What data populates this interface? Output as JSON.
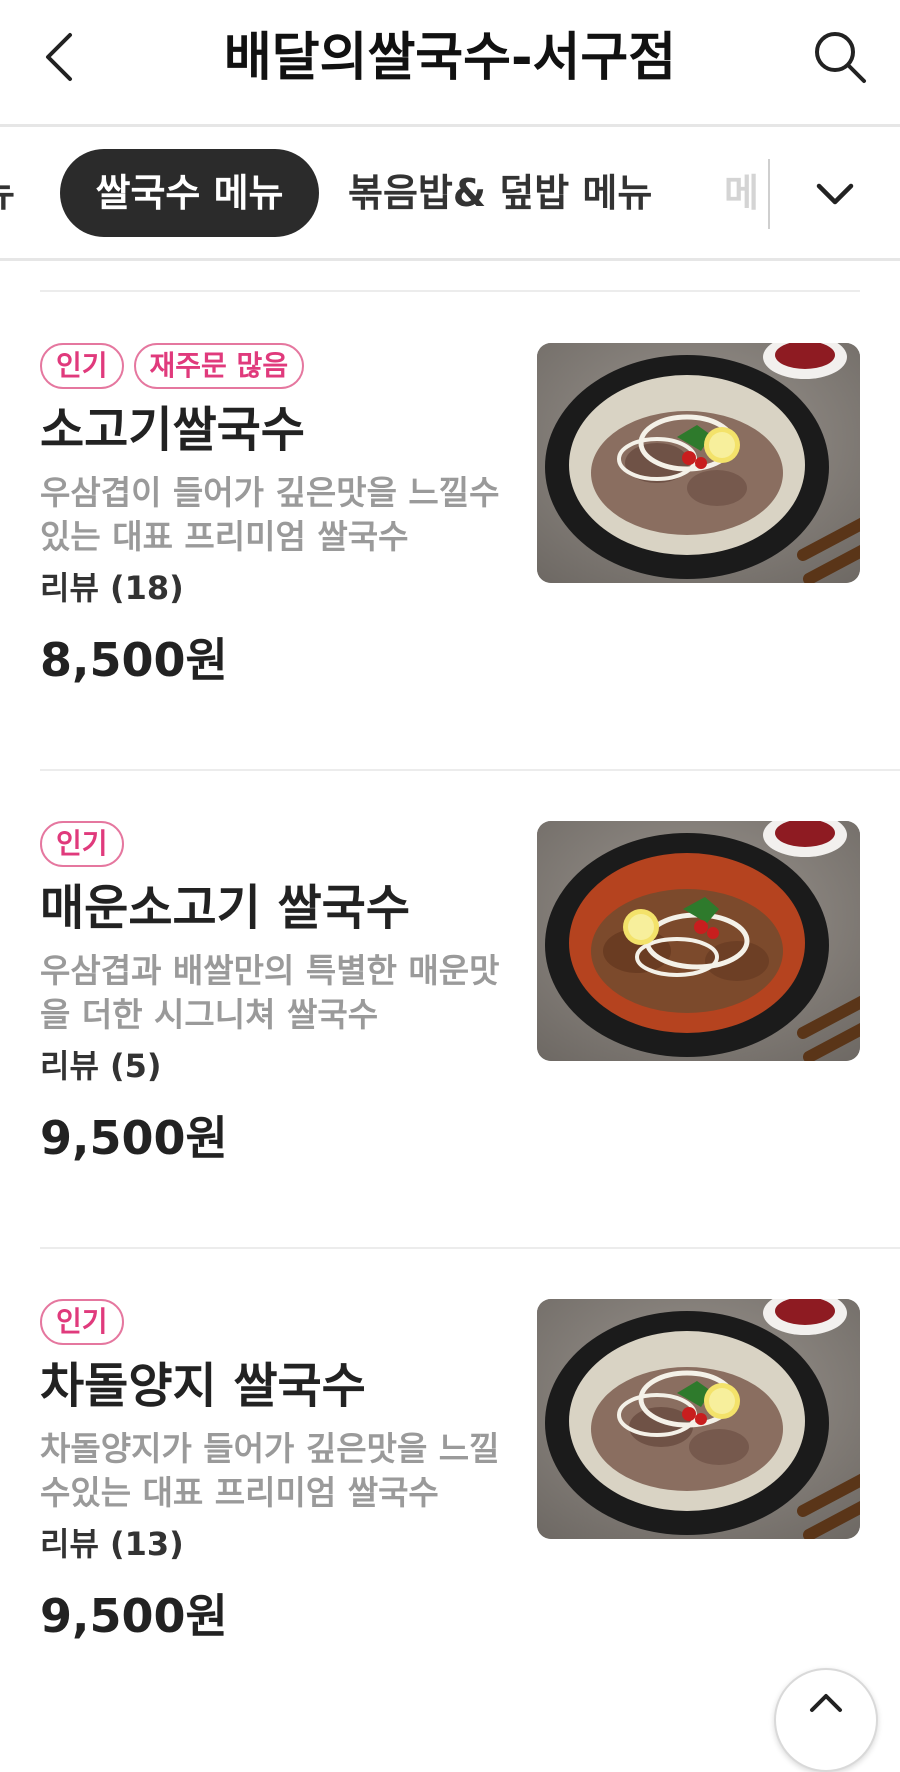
{
  "header": {
    "title": "배달의쌀국수-서구점",
    "back_icon": "chevron-left-icon",
    "search_icon": "search-icon"
  },
  "tabs": {
    "items": [
      {
        "label": "뉴",
        "state": "partial"
      },
      {
        "label": "쌀국수 메뉴",
        "state": "active"
      },
      {
        "label": "볶음밥& 덮밥 메뉴",
        "state": "normal"
      },
      {
        "label": "메",
        "state": "partial"
      }
    ],
    "toggle_icon": "chevron-down-icon"
  },
  "menu": {
    "items": [
      {
        "badges": [
          "인기",
          "재주문 많음"
        ],
        "name": "소고기쌀국수",
        "description": "우삼겹이 들어가 깊은맛을 느낄수있는 대표 프리미엄 쌀국수",
        "review": "리뷰 (18)",
        "price": "8,500원",
        "photo": "clear-broth-beef-pho"
      },
      {
        "badges": [
          "인기"
        ],
        "name": "매운소고기 쌀국수",
        "description": "우삼겹과 배쌀만의 특별한 매운맛을 더한 시그니쳐 쌀국수",
        "review": "리뷰 (5)",
        "price": "9,500원",
        "photo": "spicy-beef-pho"
      },
      {
        "badges": [
          "인기"
        ],
        "name": "차돌양지 쌀국수",
        "description": "차돌양지가 들어가 깊은맛을 느낄수있는 대표 프리미엄 쌀국수",
        "review": "리뷰 (13)",
        "price": "9,500원",
        "photo": "brisket-pho"
      }
    ]
  },
  "scroll_top_icon": "arrow-up-icon",
  "colors": {
    "badge_pink": "#e03a7c",
    "active_tab_bg": "#2b2b2b",
    "description_gray": "#9a9a9a"
  }
}
